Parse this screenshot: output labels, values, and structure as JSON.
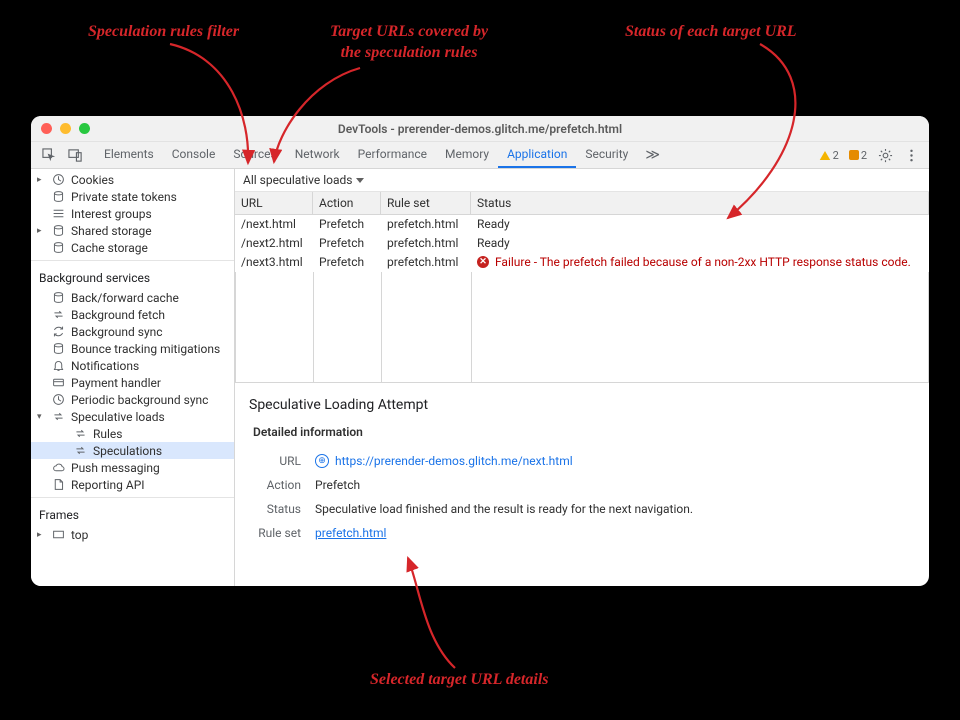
{
  "annotations": {
    "filter": "Speculation rules filter",
    "targets": "Target URLs covered by\nthe speculation rules",
    "status": "Status of each target URL",
    "details": "Selected target URL details"
  },
  "window": {
    "title": "DevTools - prerender-demos.glitch.me/prefetch.html"
  },
  "toolbar": {
    "tabs": [
      "Elements",
      "Console",
      "Sources",
      "Network",
      "Performance",
      "Memory",
      "Application",
      "Security"
    ],
    "active_tab": "Application",
    "overflow": "≫",
    "warnings_count": "2",
    "issues_count": "2"
  },
  "sidebar": {
    "storage_items": [
      {
        "icon": "clock",
        "label": "Cookies",
        "expandable": true
      },
      {
        "icon": "db",
        "label": "Private state tokens"
      },
      {
        "icon": "dblines",
        "label": "Interest groups"
      },
      {
        "icon": "db",
        "label": "Shared storage",
        "expandable": true
      },
      {
        "icon": "db",
        "label": "Cache storage"
      }
    ],
    "bg_title": "Background services",
    "bg_items": [
      {
        "icon": "db",
        "label": "Back/forward cache"
      },
      {
        "icon": "arrows",
        "label": "Background fetch"
      },
      {
        "icon": "sync",
        "label": "Background sync"
      },
      {
        "icon": "db",
        "label": "Bounce tracking mitigations"
      },
      {
        "icon": "bell",
        "label": "Notifications"
      },
      {
        "icon": "card",
        "label": "Payment handler"
      },
      {
        "icon": "clock",
        "label": "Periodic background sync"
      },
      {
        "icon": "arrows",
        "label": "Speculative loads",
        "expandable": true,
        "expanded": true
      },
      {
        "icon": "arrows",
        "label": "Rules",
        "child": true
      },
      {
        "icon": "arrows",
        "label": "Speculations",
        "child": true,
        "selected": true
      },
      {
        "icon": "cloud",
        "label": "Push messaging"
      },
      {
        "icon": "doc",
        "label": "Reporting API"
      }
    ],
    "frames_title": "Frames",
    "frames_items": [
      {
        "icon": "rect",
        "label": "top",
        "expandable": true
      }
    ]
  },
  "filter": {
    "label": "All speculative loads"
  },
  "table": {
    "head": {
      "url": "URL",
      "action": "Action",
      "ruleset": "Rule set",
      "status": "Status"
    },
    "rows": [
      {
        "url": "/next.html",
        "action": "Prefetch",
        "ruleset": "prefetch.html",
        "status_text": "Ready",
        "error": false
      },
      {
        "url": "/next2.html",
        "action": "Prefetch",
        "ruleset": "prefetch.html",
        "status_text": "Ready",
        "error": false
      },
      {
        "url": "/next3.html",
        "action": "Prefetch",
        "ruleset": "prefetch.html",
        "status_text": "Failure - The prefetch failed because of a non-2xx HTTP response status code.",
        "error": true
      }
    ]
  },
  "detail": {
    "title": "Speculative Loading Attempt",
    "subhead": "Detailed information",
    "url_label": "URL",
    "url_value": "https://prerender-demos.glitch.me/next.html",
    "action_label": "Action",
    "action_value": "Prefetch",
    "status_label": "Status",
    "status_value": "Speculative load finished and the result is ready for the next navigation.",
    "ruleset_label": "Rule set",
    "ruleset_value": "prefetch.html"
  }
}
